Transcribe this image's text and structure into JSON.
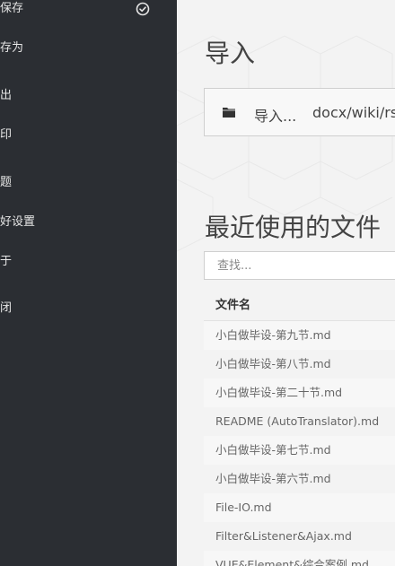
{
  "sidebar": {
    "items": [
      {
        "label": "保存",
        "checked": true
      },
      {
        "label": "存为"
      },
      {
        "label": "出"
      },
      {
        "label": "印"
      },
      {
        "label": "题"
      },
      {
        "label": "好设置"
      },
      {
        "label": "于"
      },
      {
        "label": "闭"
      }
    ]
  },
  "main": {
    "import_title": "导入",
    "import_label": "导入...",
    "import_path": "docx/wiki/rs",
    "recent_title": "最近使用的文件",
    "search_placeholder": "查找...",
    "table_header": "文件名",
    "files": [
      "小白做毕设-第九节.md",
      "小白做毕设-第八节.md",
      "小白做毕设-第二十节.md",
      "README (AutoTranslator).md",
      "小白做毕设-第七节.md",
      "小白做毕设-第六节.md",
      "File-IO.md",
      "Filter&Listener&Ajax.md",
      "VUE&Element&综合案例.md"
    ]
  },
  "colors": {
    "sidebar_bg": "#2b2e33",
    "sidebar_text": "#e6e6e6",
    "main_bg": "#f3f3f3",
    "text_dark": "#444444"
  },
  "icons": {
    "checked": "check-circle-icon",
    "folder": "folder-icon"
  }
}
